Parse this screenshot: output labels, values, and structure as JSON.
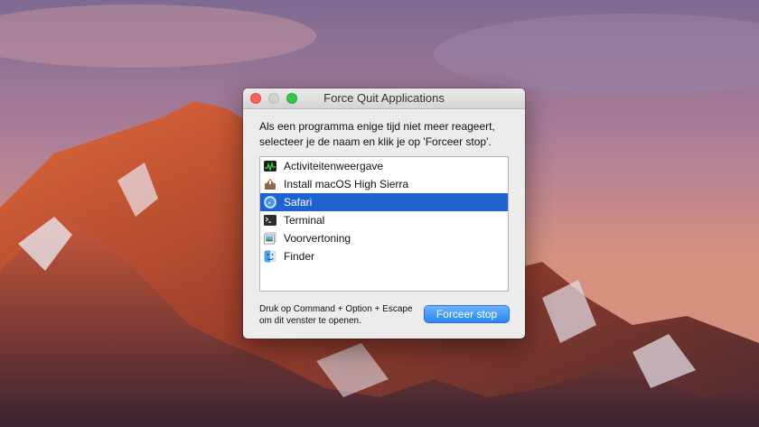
{
  "window": {
    "title": "Force Quit Applications",
    "instruction_line1": "Als een programma enige tijd niet meer reageert,",
    "instruction_line2": "selecteer je de naam en klik je op 'Forceer stop'."
  },
  "apps": [
    {
      "name": "Activiteitenweergave",
      "icon": "activity-monitor-icon",
      "selected": false
    },
    {
      "name": "Install macOS High Sierra",
      "icon": "installer-icon",
      "selected": false
    },
    {
      "name": "Safari",
      "icon": "safari-compass-icon",
      "selected": true
    },
    {
      "name": "Terminal",
      "icon": "terminal-icon",
      "selected": false
    },
    {
      "name": "Voorvertoning",
      "icon": "preview-icon",
      "selected": false
    },
    {
      "name": "Finder",
      "icon": "finder-icon",
      "selected": false
    }
  ],
  "footer": {
    "hint_line1": "Druk op Command + Option + Escape",
    "hint_line2": "om dit venster te openen."
  },
  "buttons": {
    "force_quit": "Forceer stop"
  },
  "colors": {
    "selection": "#1e62d0",
    "button": "#2a84f2",
    "close": "#fc605c",
    "zoom": "#34c84a"
  }
}
